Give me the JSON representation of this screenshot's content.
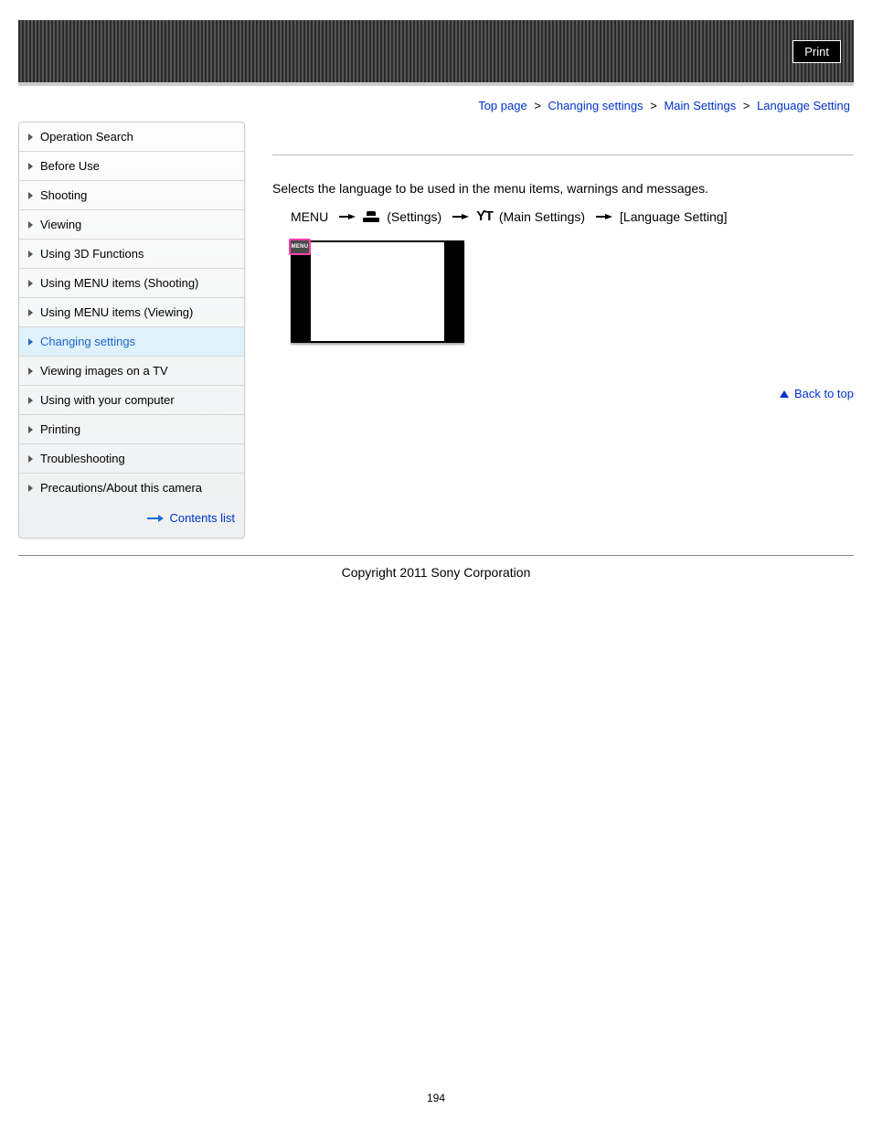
{
  "header": {
    "print_label": "Print"
  },
  "breadcrumb": {
    "items": [
      "Top page",
      "Changing settings",
      "Main Settings",
      "Language Setting"
    ],
    "separator": ">"
  },
  "sidebar": {
    "items": [
      {
        "label": "Operation Search",
        "active": false
      },
      {
        "label": "Before Use",
        "active": false
      },
      {
        "label": "Shooting",
        "active": false
      },
      {
        "label": "Viewing",
        "active": false
      },
      {
        "label": "Using 3D Functions",
        "active": false
      },
      {
        "label": "Using MENU items (Shooting)",
        "active": false
      },
      {
        "label": "Using MENU items (Viewing)",
        "active": false
      },
      {
        "label": "Changing settings",
        "active": true
      },
      {
        "label": "Viewing images on a TV",
        "active": false
      },
      {
        "label": "Using with your computer",
        "active": false
      },
      {
        "label": "Printing",
        "active": false
      },
      {
        "label": "Troubleshooting",
        "active": false
      },
      {
        "label": "Precautions/About this camera",
        "active": false
      }
    ],
    "contents_link": "Contents list"
  },
  "main": {
    "description": "Selects the language to be used in the menu items, warnings and messages.",
    "path": {
      "start": "MENU",
      "step1": "(Settings)",
      "step2": "(Main Settings)",
      "step3": "[Language Setting]"
    },
    "menu_badge": "MENU",
    "back_to_top": "Back to top"
  },
  "footer": {
    "copyright": "Copyright 2011 Sony Corporation",
    "page_number": "194"
  }
}
